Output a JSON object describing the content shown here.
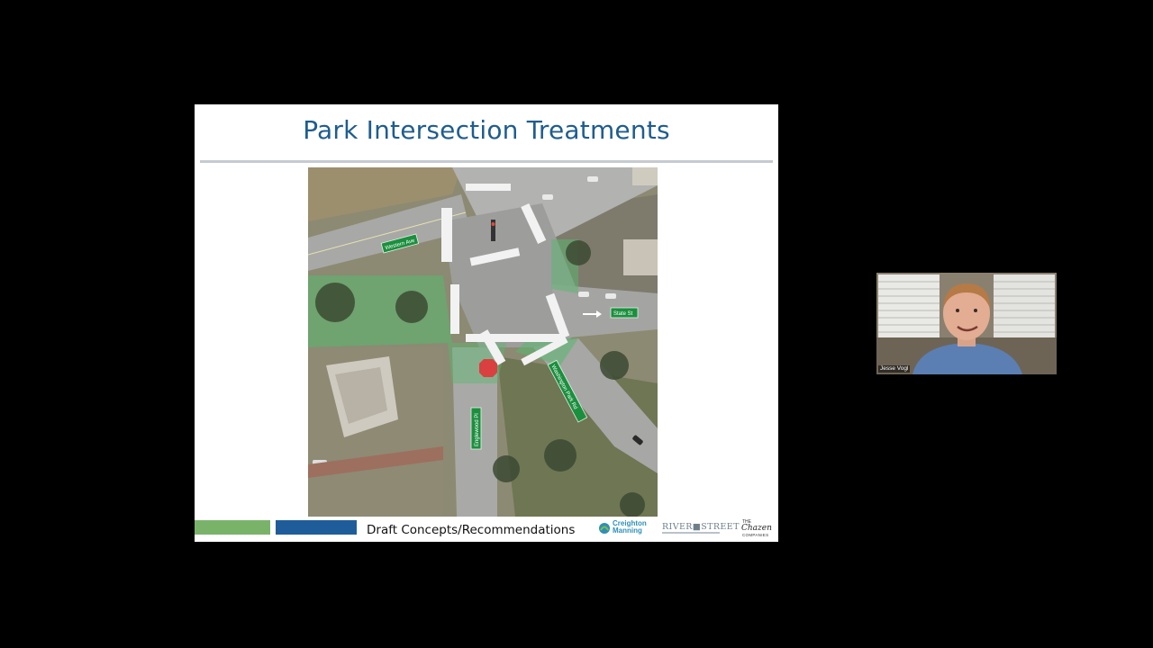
{
  "slide": {
    "title": "Park Intersection Treatments",
    "footer_text": "Draft Concepts/Recommendations",
    "street_signs": {
      "western": "Western Ave",
      "state": "State St",
      "englewood": "Englewood Pl",
      "washington_park": "Washington Park Rd"
    },
    "logos": {
      "creighton_line1": "Creighton",
      "creighton_line2": "Manning",
      "riverstreet": "RIVER■STREET",
      "chazen_small": "THE",
      "chazen_big": "Chazen",
      "chazen_small2": "COMPANIES"
    },
    "colors": {
      "title": "#1f5d8f",
      "bar_green": "#79b36a",
      "bar_blue": "#1f5d9a"
    }
  },
  "video": {
    "participant_name": "Jesse Vogl"
  }
}
